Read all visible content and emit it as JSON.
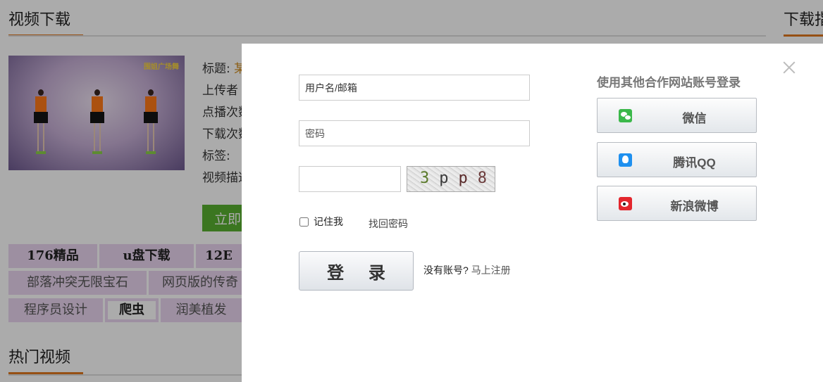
{
  "background": {
    "video_section_title": "视频下载",
    "download_section_title": "下载指",
    "hot_section_title": "热门视频",
    "thumbnail_logo": "围姐广场舞",
    "meta_labels": [
      "标题:",
      "上传者",
      "点播次数",
      "下载次数",
      "标签:",
      "视频描述"
    ],
    "meta_title_value": "某",
    "download_button": "立即",
    "tags_row1": [
      "176精品",
      "u盘下载",
      "12E"
    ],
    "tags_row2": [
      "部落冲突无限宝石",
      "网页版的传奇"
    ],
    "tags_row3": [
      "程序员设计",
      "爬虫",
      "润美植发"
    ]
  },
  "login": {
    "username_placeholder": "用户名/邮箱",
    "password_placeholder": "密码",
    "captcha_text": [
      "3",
      "p",
      "p",
      "8"
    ],
    "remember_me": "记住我",
    "forgot_password": "找回密码",
    "login_button": "登 录",
    "no_account": "没有账号?",
    "register_link": "马上注册",
    "oauth_title": "使用其他合作网站账号登录",
    "oauth_buttons": [
      {
        "label": "微信",
        "icon": "wechat-icon"
      },
      {
        "label": "腾讯QQ",
        "icon": "qq-icon"
      },
      {
        "label": "新浪微博",
        "icon": "weibo-icon"
      }
    ]
  },
  "colors": {
    "accent_orange": "#e0781e",
    "download_green": "#59b030",
    "tag_bg": "#ead6f0"
  }
}
